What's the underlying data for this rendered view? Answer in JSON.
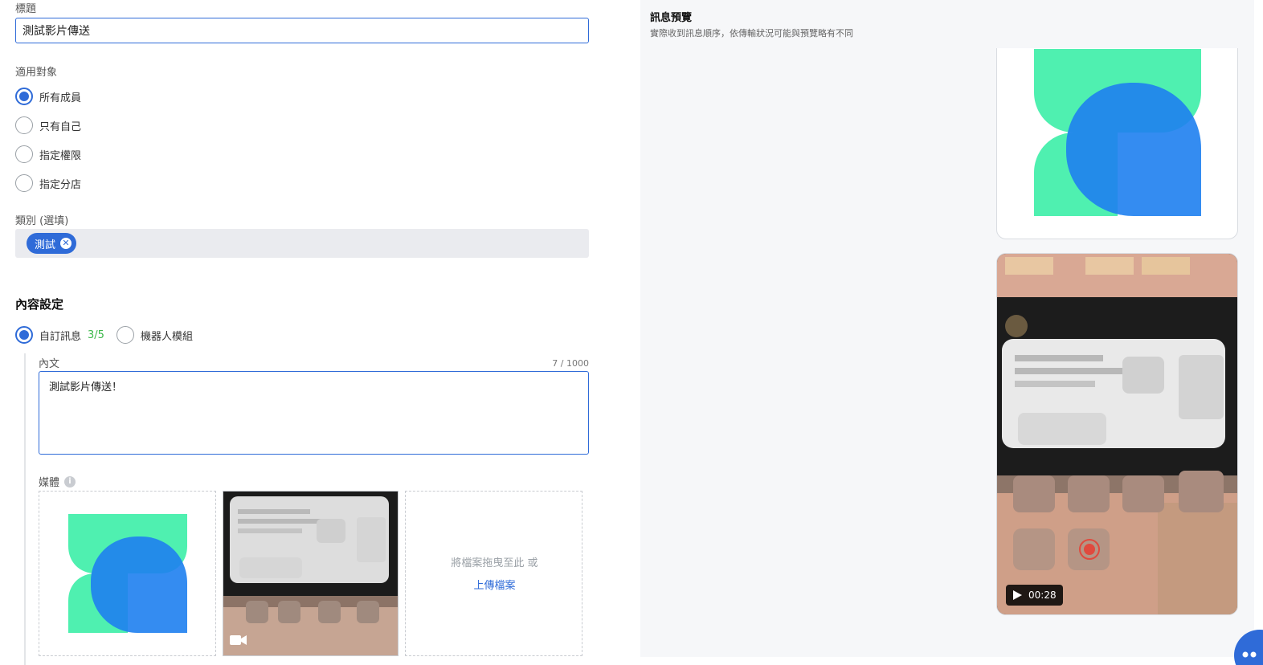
{
  "form": {
    "title_label": "標題",
    "title_value": "測試影片傳送",
    "audience_label": "適用對象",
    "audience_options": [
      {
        "label": "所有成員",
        "checked": true
      },
      {
        "label": "只有自己",
        "checked": false
      },
      {
        "label": "指定權限",
        "checked": false
      },
      {
        "label": "指定分店",
        "checked": false
      }
    ],
    "category_label": "類別 (選填)",
    "category_tag": "測試",
    "content_section_title": "內容設定",
    "content_type": {
      "custom_label": "自訂訊息",
      "custom_count": "3/5",
      "custom_checked": true,
      "bot_label": "機器人模組",
      "bot_checked": false
    },
    "body_label": "內文",
    "body_counter": "7 / 1000",
    "body_value": "測試影片傳送！",
    "media_label": "媒體",
    "upload": {
      "hint": "將檔案拖曳至此 或",
      "link": "上傳檔案"
    }
  },
  "preview": {
    "title": "訊息預覽",
    "subtitle": "實際收到訊息順序，依傳輸狀況可能與預覽略有不同",
    "video_duration": "00:28"
  },
  "colors": {
    "accent": "#2f6bd8",
    "green": "#3cb84a",
    "logo_green": "#4ff0b0",
    "logo_blue": "#1e7ff0"
  },
  "icons": [
    "info-icon",
    "video-camera-icon",
    "play-icon",
    "close-icon",
    "chat-launcher-icon"
  ]
}
